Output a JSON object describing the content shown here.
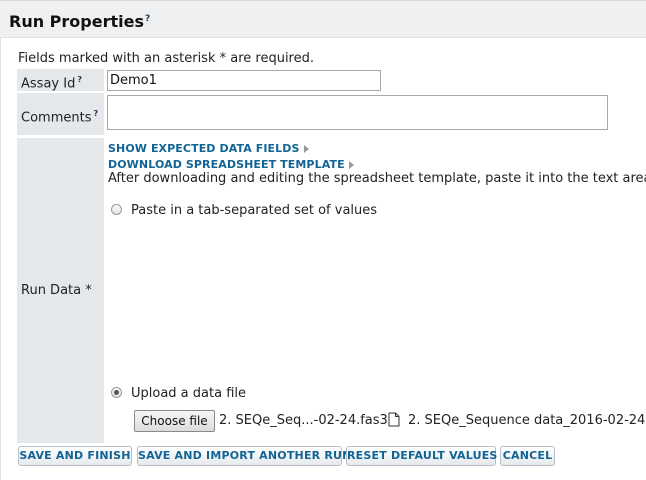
{
  "header": {
    "title": "Run Properties",
    "help_mark": "?"
  },
  "form": {
    "required_note": "Fields marked with an asterisk * are required.",
    "assay_id": {
      "label": "Assay Id",
      "help_mark": "?",
      "value": "Demo1"
    },
    "comments": {
      "label": "Comments",
      "help_mark": "?",
      "value": ""
    },
    "run_data": {
      "label": "Run Data *",
      "show_fields_link": "SHOW EXPECTED DATA FIELDS",
      "download_template_link": "DOWNLOAD SPREADSHEET TEMPLATE",
      "instructions": "After downloading and editing the spreadsheet template, paste it into the text area",
      "paste_option": {
        "label": "Paste in a tab-separated set of values",
        "checked": false
      },
      "upload_option": {
        "label": "Upload a data file",
        "checked": true
      },
      "choose_file_label": "Choose file",
      "chosen_file_short": "2. SEQe_Seq...-02-24.fas3",
      "existing_file_name": "2. SEQe_Sequence data_2016-02-24"
    }
  },
  "actions": {
    "save_finish": "SAVE AND FINISH",
    "save_import": "SAVE AND IMPORT ANOTHER RUN",
    "reset": "RESET DEFAULT VALUES",
    "cancel": "CANCEL"
  },
  "colors": {
    "link": "#126495",
    "label_bg": "#e4e8eb",
    "header_bg": "#eef0f2"
  },
  "icons": {
    "file": "document-icon"
  }
}
